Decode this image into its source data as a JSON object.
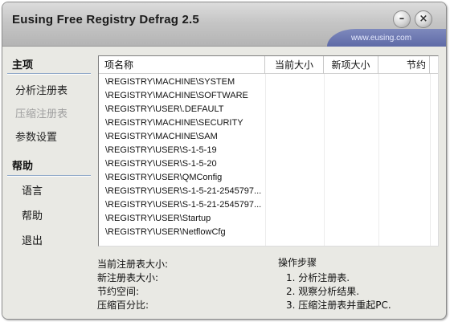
{
  "window": {
    "title": "Eusing Free Registry Defrag 2.5",
    "url": "www.eusing.com",
    "minimize_glyph": "–",
    "close_glyph": "×"
  },
  "sidebar": {
    "main_section": "主项",
    "main_items": [
      {
        "label": "分析注册表",
        "enabled": true
      },
      {
        "label": "压缩注册表",
        "enabled": false
      },
      {
        "label": "参数设置",
        "enabled": true
      }
    ],
    "help_section": "帮助",
    "help_items": [
      {
        "label": "语言"
      },
      {
        "label": "帮助"
      },
      {
        "label": "退出"
      }
    ]
  },
  "table": {
    "columns": [
      "项名称",
      "当前大小",
      "新项大小",
      "节约"
    ],
    "rows": [
      [
        "\\REGISTRY\\MACHINE\\SYSTEM",
        "",
        "",
        ""
      ],
      [
        "\\REGISTRY\\MACHINE\\SOFTWARE",
        "",
        "",
        ""
      ],
      [
        "\\REGISTRY\\USER\\.DEFAULT",
        "",
        "",
        ""
      ],
      [
        "\\REGISTRY\\MACHINE\\SECURITY",
        "",
        "",
        ""
      ],
      [
        "\\REGISTRY\\MACHINE\\SAM",
        "",
        "",
        ""
      ],
      [
        "\\REGISTRY\\USER\\S-1-5-19",
        "",
        "",
        ""
      ],
      [
        "\\REGISTRY\\USER\\S-1-5-20",
        "",
        "",
        ""
      ],
      [
        "\\REGISTRY\\USER\\QMConfig",
        "",
        "",
        ""
      ],
      [
        "\\REGISTRY\\USER\\S-1-5-21-2545797...",
        "",
        "",
        ""
      ],
      [
        "\\REGISTRY\\USER\\S-1-5-21-2545797...",
        "",
        "",
        ""
      ],
      [
        "\\REGISTRY\\USER\\Startup",
        "",
        "",
        ""
      ],
      [
        "\\REGISTRY\\USER\\NetflowCfg",
        "",
        "",
        ""
      ]
    ]
  },
  "stats": {
    "current_size_label": "当前注册表大小:",
    "new_size_label": "新注册表大小:",
    "saved_label": "节约空间:",
    "compress_ratio_label": "压缩百分比:"
  },
  "steps": {
    "title": "操作步骤",
    "items": [
      "1. 分析注册表.",
      "2. 观察分析结果.",
      "3. 压缩注册表并重起PC."
    ]
  },
  "colors": {
    "window_bg": "#e9e9e4",
    "title_bar": "#c6c6c6",
    "url_plate": "#6e79b1",
    "section_line": "#8fa8c8",
    "disabled_text": "#a0a0a0"
  }
}
